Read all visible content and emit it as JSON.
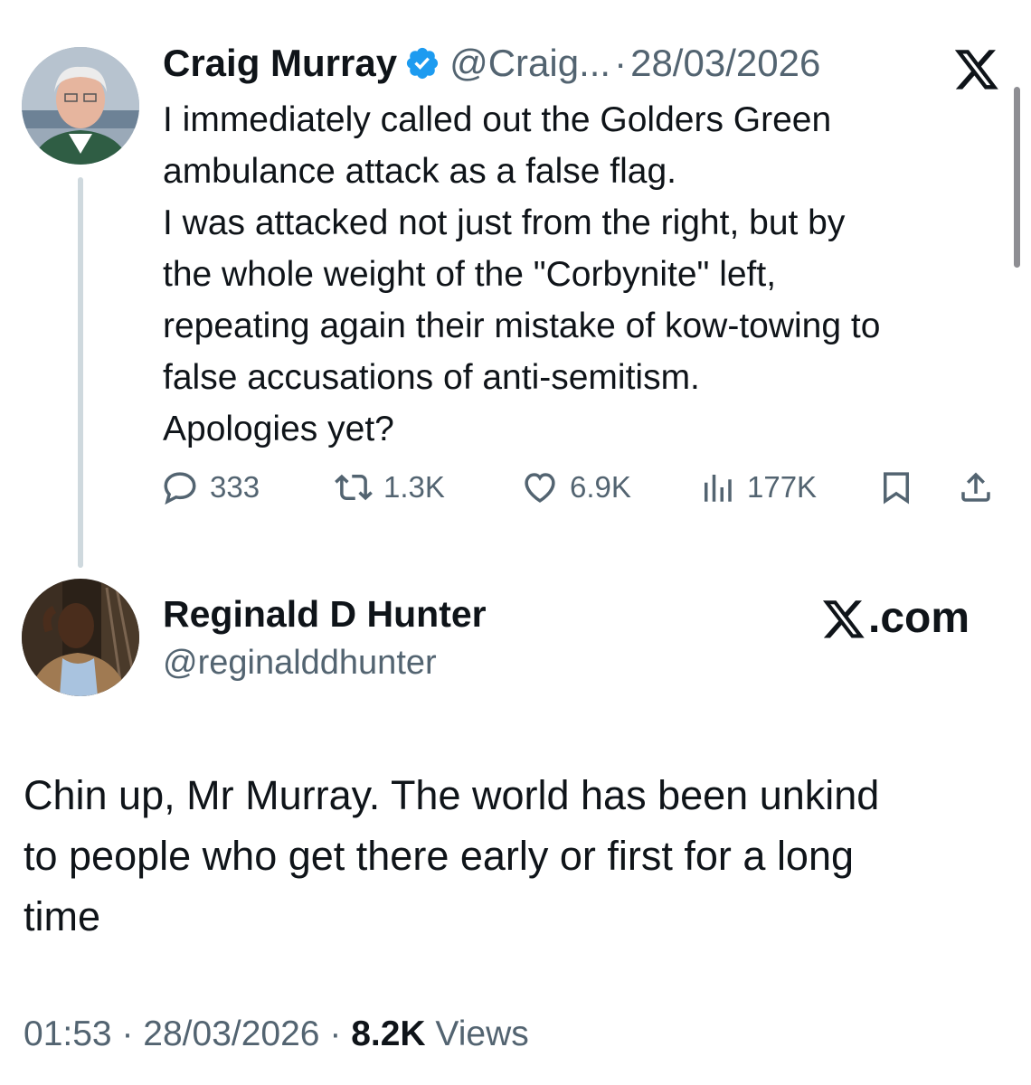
{
  "tweet1": {
    "author_name": "Craig Murray",
    "handle": "@Craig...",
    "separator": "·",
    "date": "28/03/2026",
    "body_lines": [
      "I immediately called out the Golders Green",
      "ambulance attack as a false flag.",
      "I was attacked not just from the right, but by",
      "the whole weight of the \"Corbynite\" left,",
      "repeating again their mistake of kow-towing to",
      "false accusations of anti-semitism.",
      "Apologies yet?"
    ],
    "replies": "333",
    "reposts": "1.3K",
    "likes": "6.9K",
    "views": "177K",
    "icons": [
      "reply-icon",
      "repost-icon",
      "like-icon",
      "views-icon",
      "bookmark-icon",
      "share-icon",
      "verified-badge-icon",
      "x-logo-icon"
    ],
    "accent_color": "#1d9bf0"
  },
  "tweet2": {
    "author_name": "Reginald D Hunter",
    "handle": "@reginalddhunter",
    "brand": ".com",
    "body_lines": [
      "Chin up, Mr Murray. The world has been unkind",
      "to people who get there early or first for a long",
      "time"
    ],
    "time": "01:53",
    "sep1": "·",
    "date": "28/03/2026",
    "sep2": "·",
    "views_count": "8.2K",
    "views_label": "Views"
  }
}
